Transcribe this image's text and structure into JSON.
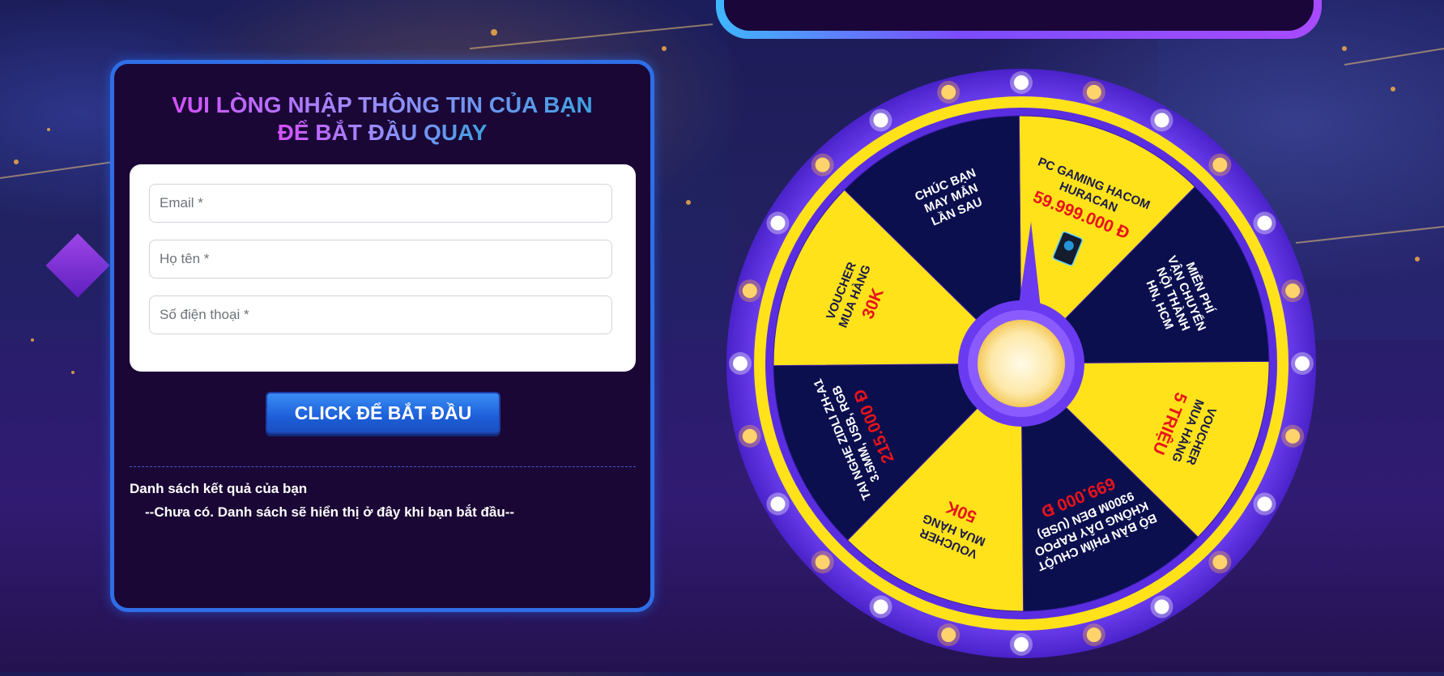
{
  "form": {
    "title_line1": "VUI LÒNG NHẬP THÔNG TIN CỦA BẠN",
    "title_line2": "ĐỂ BẮT ĐẦU QUAY",
    "fields": {
      "email_placeholder": "Email *",
      "name_placeholder": "Họ tên *",
      "phone_placeholder": "Số điện thoại *"
    },
    "start_button": "CLICK ĐỂ BẮT ĐẦU",
    "results_heading": "Danh sách kết quả của bạn",
    "results_empty": "--Chưa có. Danh sách sẽ hiển thị ở đây khi bạn bắt đầu--"
  },
  "wheel": {
    "segments": [
      {
        "lines": [
          "PC GAMING HACOM",
          "HURACAN"
        ],
        "highlight": "59.999.000 Đ",
        "color": "#ffe21a",
        "icon": "pc-case-icon"
      },
      {
        "lines": [
          "MIỄN PHÍ",
          "VẬN CHUYỂN",
          "NỘI THÀNH",
          "HN, HCM"
        ],
        "highlight": "",
        "color": "#0b0f4e"
      },
      {
        "lines": [
          "VOUCHER",
          "MUA HÀNG"
        ],
        "highlight": "5 TRIỆU",
        "color": "#ffe21a"
      },
      {
        "lines": [
          "BỘ BÀN PHÍM CHUỘT",
          "KHÔNG DÂY RAPOO",
          "9300M ĐEN (USB)"
        ],
        "highlight": "699.000 Đ",
        "color": "#0b0f4e"
      },
      {
        "lines": [
          "VOUCHER",
          "MUA HÀNG"
        ],
        "highlight": "50K",
        "color": "#ffe21a"
      },
      {
        "lines": [
          "TAI NGHE ZIDLI ZH-A1",
          "3.5MM, USB, RGB"
        ],
        "highlight": "215.000 Đ",
        "color": "#0b0f4e"
      },
      {
        "lines": [
          "VOUCHER",
          "MUA HÀNG"
        ],
        "highlight": "30K",
        "color": "#ffe21a"
      },
      {
        "lines": [
          "CHÚC BẠN",
          "MAY MẮN",
          "LẦN SAU"
        ],
        "highlight": "",
        "color": "#0b0f4e"
      }
    ],
    "rim_color": "#6a3af0",
    "gold_color": "#ffe21a",
    "highlight_color": "#e8131b"
  }
}
